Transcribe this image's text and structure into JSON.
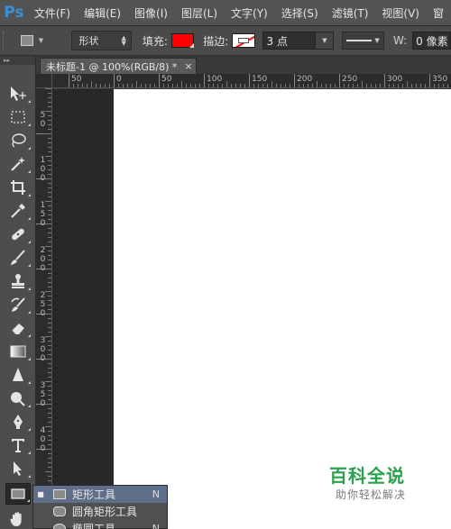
{
  "app": {
    "logo": "Ps"
  },
  "menu": [
    "文件(F)",
    "编辑(E)",
    "图像(I)",
    "图层(L)",
    "文字(Y)",
    "选择(S)",
    "滤镜(T)",
    "视图(V)",
    "窗"
  ],
  "options": {
    "mode": "形状",
    "fill_label": "填充:",
    "fill_color": "#ff0000",
    "stroke_label": "描边:",
    "stroke_size": "3 点",
    "width_label": "W:",
    "width_value": "0 像素"
  },
  "document": {
    "tab_title": "未标题-1 @ 100%(RGB/8) *",
    "close_glyph": "×"
  },
  "ruler_top_labels": [
    "50",
    "0",
    "50",
    "100",
    "150",
    "200",
    "250",
    "300",
    "350"
  ],
  "ruler_left_labels": [
    "5\n0",
    "1\n0\n0",
    "1\n5\n0",
    "2\n0\n0",
    "2\n5\n0",
    "3\n0\n0",
    "3\n5\n0",
    "4\n0\n0"
  ],
  "tools": [
    "move-tool-icon",
    "marquee-tool-icon",
    "lasso-tool-icon",
    "magic-wand-tool-icon",
    "crop-tool-icon",
    "eyedropper-tool-icon",
    "healing-brush-tool-icon",
    "brush-tool-icon",
    "clone-stamp-tool-icon",
    "history-brush-tool-icon",
    "eraser-tool-icon",
    "gradient-tool-icon",
    "blur-tool-icon",
    "dodge-tool-icon",
    "pen-tool-icon",
    "type-tool-icon",
    "path-selection-tool-icon",
    "rectangle-tool-icon",
    "hand-tool-icon"
  ],
  "flyout": [
    {
      "label": "矩形工具",
      "key": "N",
      "selected": true
    },
    {
      "label": "圆角矩形工具",
      "key": "",
      "selected": false
    },
    {
      "label": "椭圆工具",
      "key": "N",
      "selected": false
    }
  ],
  "watermark": {
    "title": "百科全说",
    "subtitle": "助你轻松解决"
  }
}
